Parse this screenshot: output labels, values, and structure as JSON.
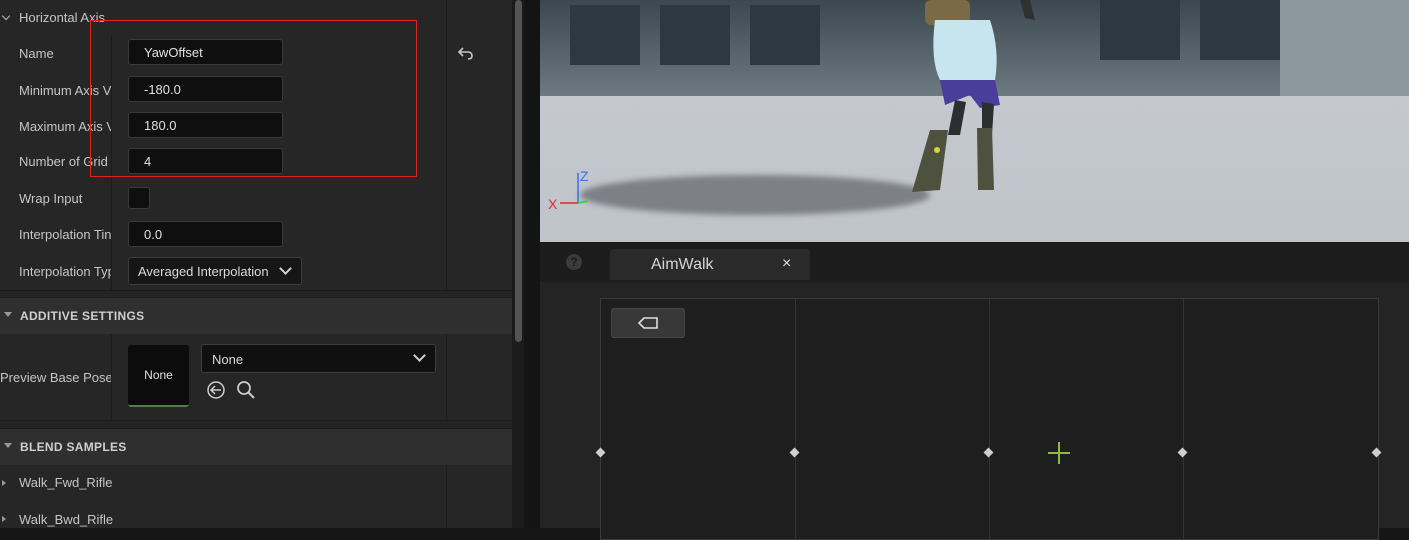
{
  "details": {
    "horizontal_axis": {
      "header": "Horizontal Axis",
      "name_label": "Name",
      "name_value": "YawOffset",
      "min_label": "Minimum Axis V",
      "min_value": "-180.0",
      "max_label": "Maximum Axis V",
      "max_value": "180.0",
      "grid_label": "Number of Grid I",
      "grid_value": "4",
      "wrap_label": "Wrap Input",
      "wrap_checked": false,
      "interp_time_label": "Interpolation Tin",
      "interp_time_value": "0.0",
      "interp_type_label": "Interpolation Typ",
      "interp_type_value": "Averaged Interpolation"
    },
    "additive_settings": {
      "title": "ADDITIVE SETTINGS",
      "preview_label": "Preview Base Pose",
      "thumbnail_text": "None",
      "asset_value": "None"
    },
    "blend_samples": {
      "title": "BLEND SAMPLES",
      "items": [
        "Walk_Fwd_Rifle",
        "Walk_Bwd_Rifle"
      ]
    }
  },
  "viewport": {
    "axis_x": "X",
    "axis_z": "Z"
  },
  "blendspace": {
    "tab_label": "AimWalk",
    "tab_close": "×",
    "help_icon": "?"
  },
  "colors": {
    "highlight": "#e0241b",
    "accent_green": "#8ebb3c",
    "axis_x": "#e02a2a",
    "axis_z": "#3a6ff0",
    "axis_y": "#3bd43b"
  }
}
